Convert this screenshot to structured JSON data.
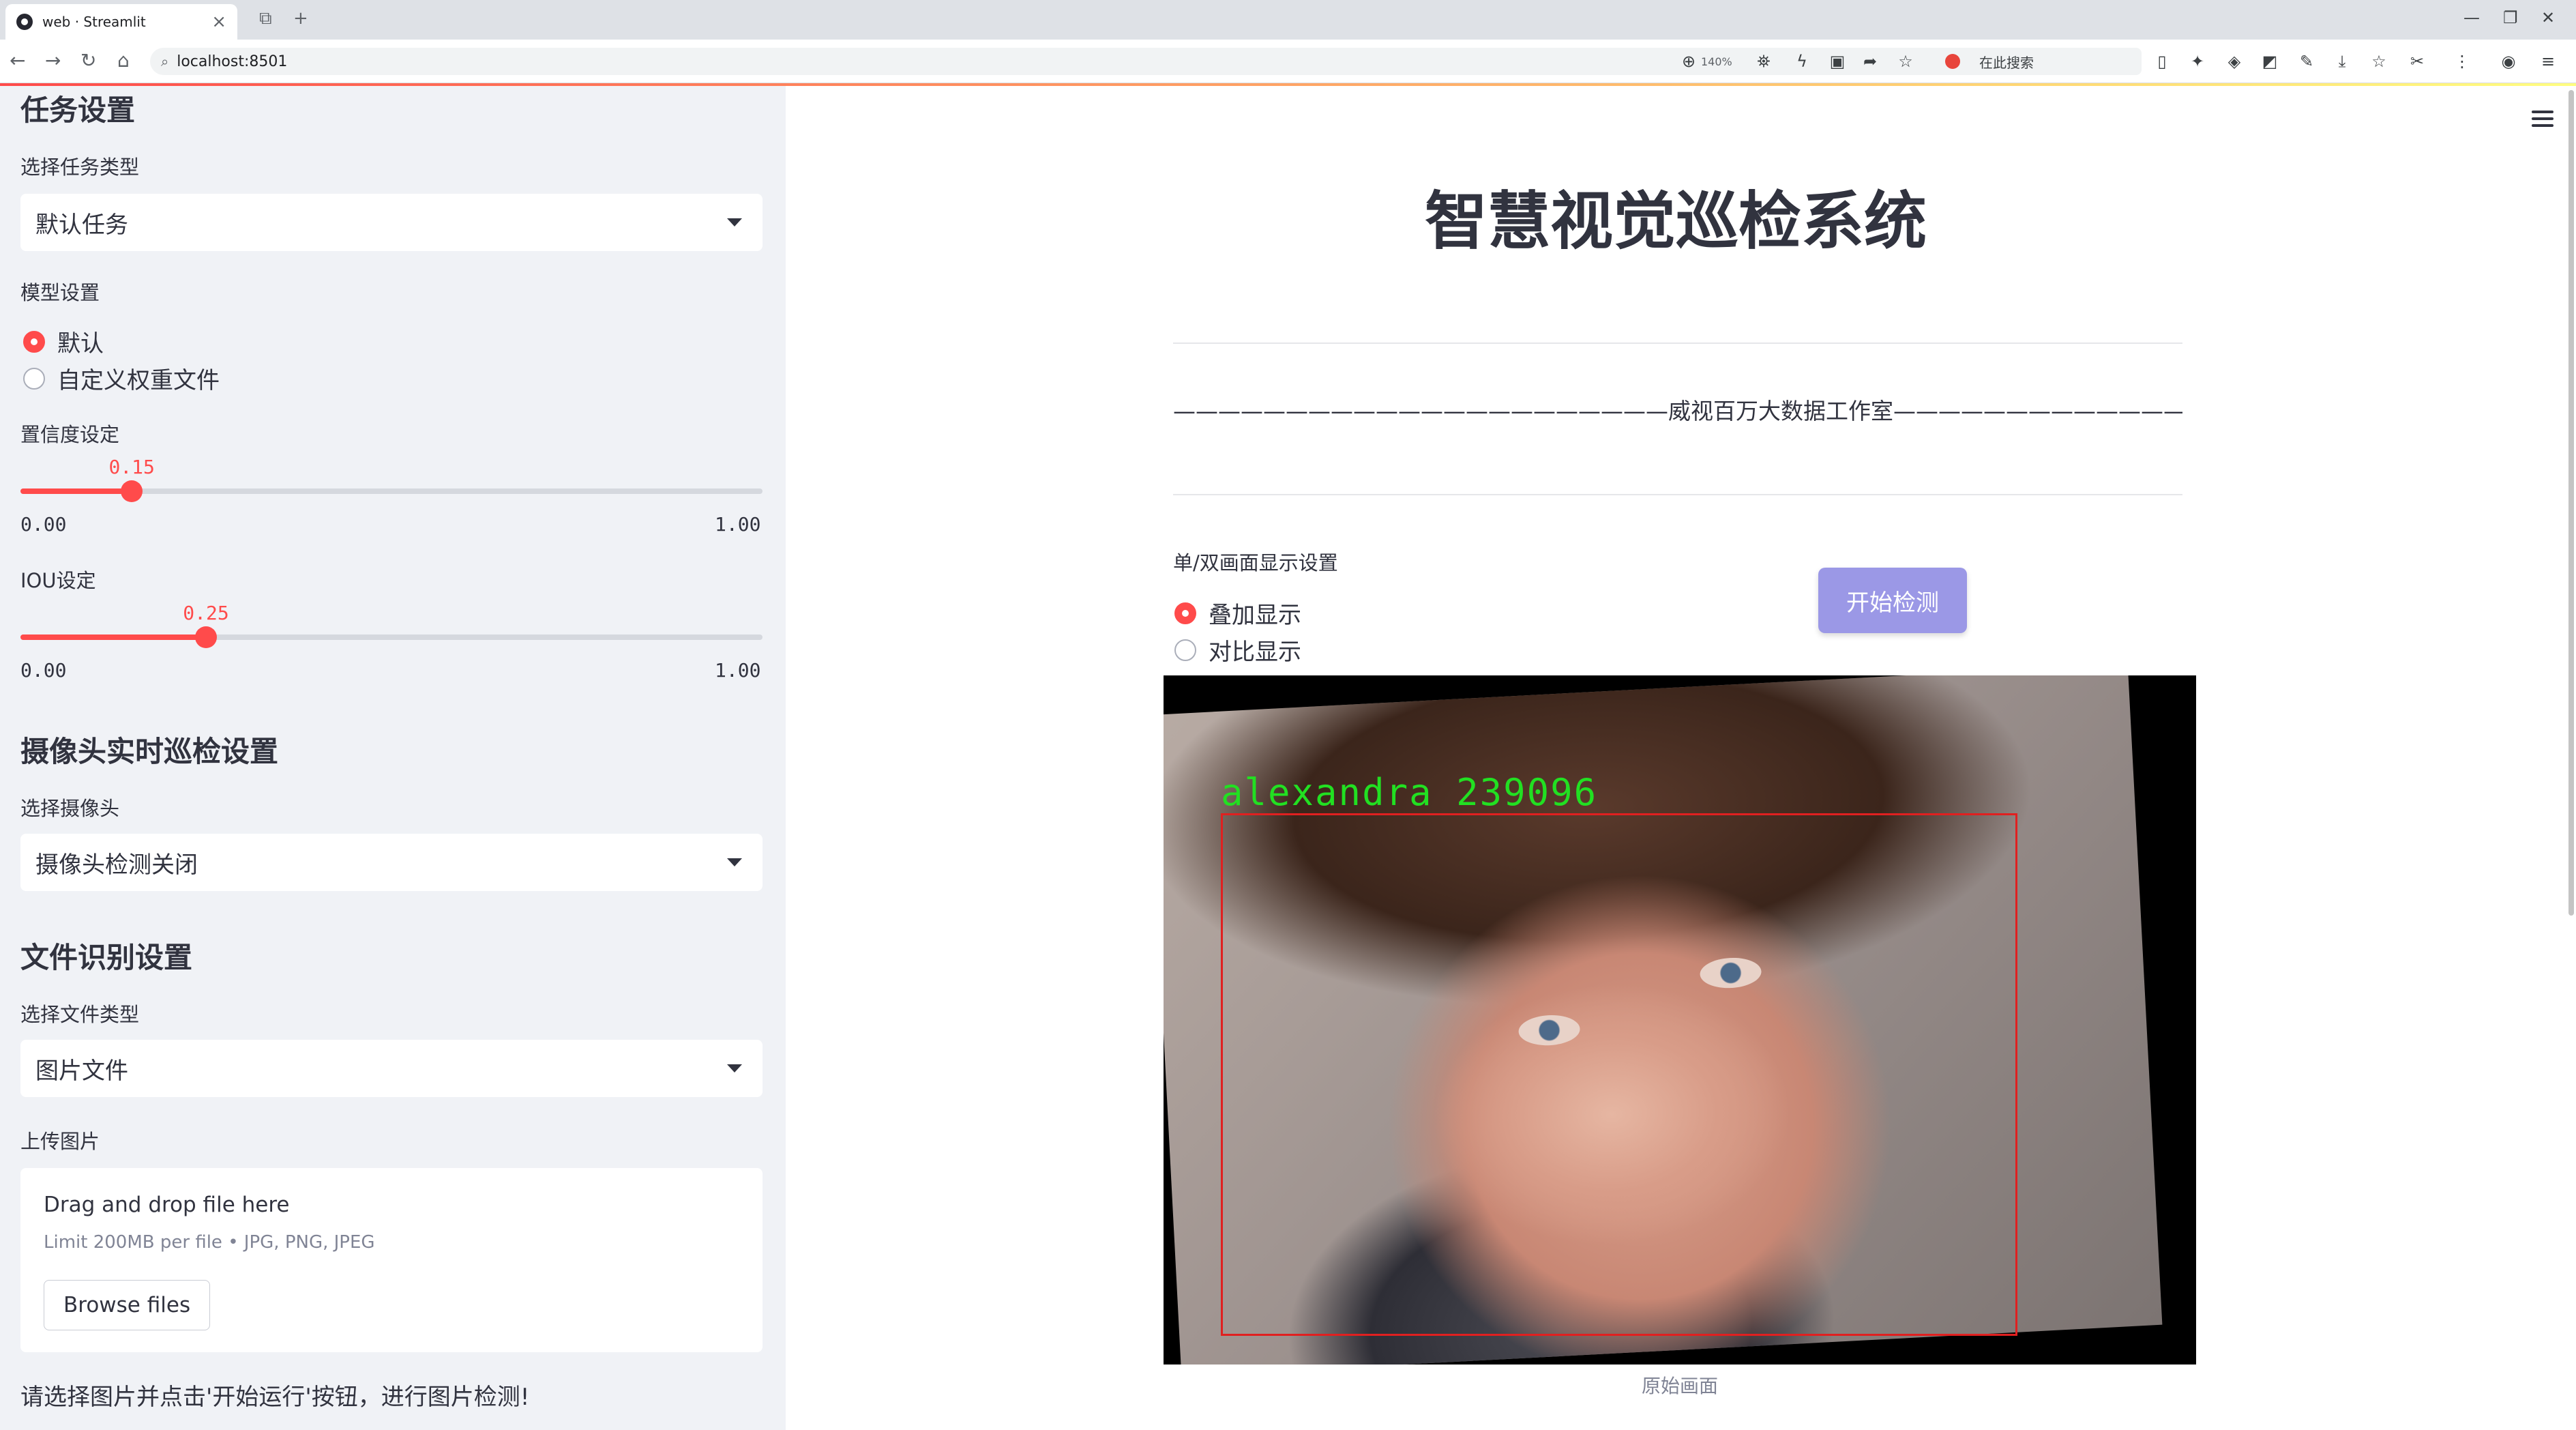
{
  "browser": {
    "tab_title": "web · Streamlit",
    "url": "localhost:8501",
    "zoom": "140%",
    "search_placeholder": "在此搜索"
  },
  "sidebar": {
    "task_header": "任务设置",
    "task_type_label": "选择任务类型",
    "task_type_value": "默认任务",
    "model_label": "模型设置",
    "model_options": [
      "默认",
      "自定义权重文件"
    ],
    "model_selected": "默认",
    "conf_label": "置信度设定",
    "conf_value": "0.15",
    "conf_min": "0.00",
    "conf_max": "1.00",
    "conf_fraction": 0.15,
    "iou_label": "IOU设定",
    "iou_value": "0.25",
    "iou_min": "0.00",
    "iou_max": "1.00",
    "iou_fraction": 0.25,
    "camera_header": "摄像头实时巡检设置",
    "camera_label": "选择摄像头",
    "camera_value": "摄像头检测关闭",
    "file_header": "文件识别设置",
    "file_type_label": "选择文件类型",
    "file_type_value": "图片文件",
    "upload_label": "上传图片",
    "upload_title": "Drag and drop file here",
    "upload_limit": "Limit 200MB per file • JPG, PNG, JPEG",
    "browse_button": "Browse files",
    "note": "请选择图片并点击'开始运行'按钮，进行图片检测!"
  },
  "main": {
    "title": "智慧视觉巡检系统",
    "studio_line": "——————————————————————威视百万大数据工作室———————————————————————",
    "display_label": "单/双画面显示设置",
    "display_options": [
      "叠加显示",
      "对比显示"
    ],
    "display_selected": "叠加显示",
    "start_button": "开始检测",
    "detection_label": "alexandra 239096",
    "image_caption": "原始画面"
  },
  "colors": {
    "accent": "#ff4b4b",
    "sidebar_bg": "#f0f2f6",
    "button_bg": "#9b98e6",
    "box_color": "#e02020",
    "label_color": "#22e022"
  }
}
